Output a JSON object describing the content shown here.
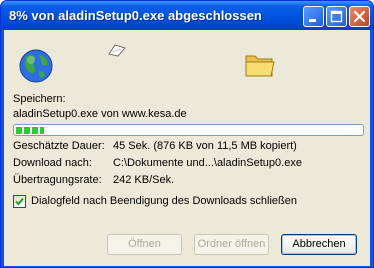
{
  "window": {
    "title": "8% von aladinSetup0.exe abgeschlossen"
  },
  "titlebar_buttons": {
    "minimize_icon": "minimize-icon",
    "maximize_icon": "maximize-icon",
    "close_icon": "close-icon"
  },
  "animation": {
    "source_icon": "globe-icon",
    "paper_icon": "flying-paper-icon",
    "target_icon": "folder-icon"
  },
  "download": {
    "status_label": "Speichern:",
    "file_line": "aladinSetup0.exe von www.kesa.de",
    "progress_fraction": 0.08,
    "rows": [
      {
        "label": "Geschätzte Dauer:",
        "value": "45 Sek. (876 KB von 11,5 MB kopiert)"
      },
      {
        "label": "Download nach:",
        "value": "C:\\Dokumente und...\\aladinSetup0.exe"
      },
      {
        "label": "Übertragungsrate:",
        "value": "242 KB/Sek."
      }
    ],
    "close_on_finish": {
      "label": "Dialogfeld nach Beendigung des Downloads schließen",
      "checked": true
    }
  },
  "buttons": {
    "open": "Öffnen",
    "open_folder": "Ordner öffnen",
    "cancel": "Abbrechen"
  },
  "colors": {
    "titlebar": "#0054e3",
    "client": "#ece9d8",
    "progress": "#2fc82f",
    "close_button": "#c1451d"
  }
}
